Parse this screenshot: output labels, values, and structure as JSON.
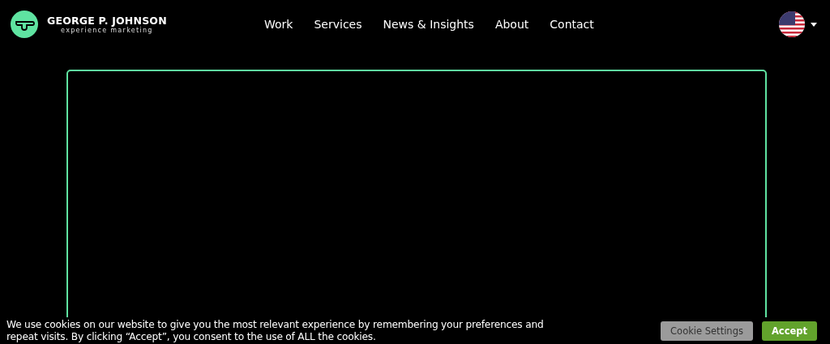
{
  "header": {
    "logo": {
      "name": "GEORGE P. JOHNSON",
      "tagline": "experience marketing"
    },
    "nav": [
      {
        "label": "Work"
      },
      {
        "label": "Services"
      },
      {
        "label": "News & Insights"
      },
      {
        "label": "About"
      },
      {
        "label": "Contact"
      }
    ]
  },
  "cookie_banner": {
    "message": "We use cookies on our website to give you the most relevant experience by remembering your preferences and repeat visits. By clicking “Accept”, you consent to the use of ALL the cookies.",
    "buttons": [
      {
        "label": "Cookie Settings",
        "kind": "secondary"
      },
      {
        "label": "Accept",
        "kind": "primary"
      }
    ]
  }
}
